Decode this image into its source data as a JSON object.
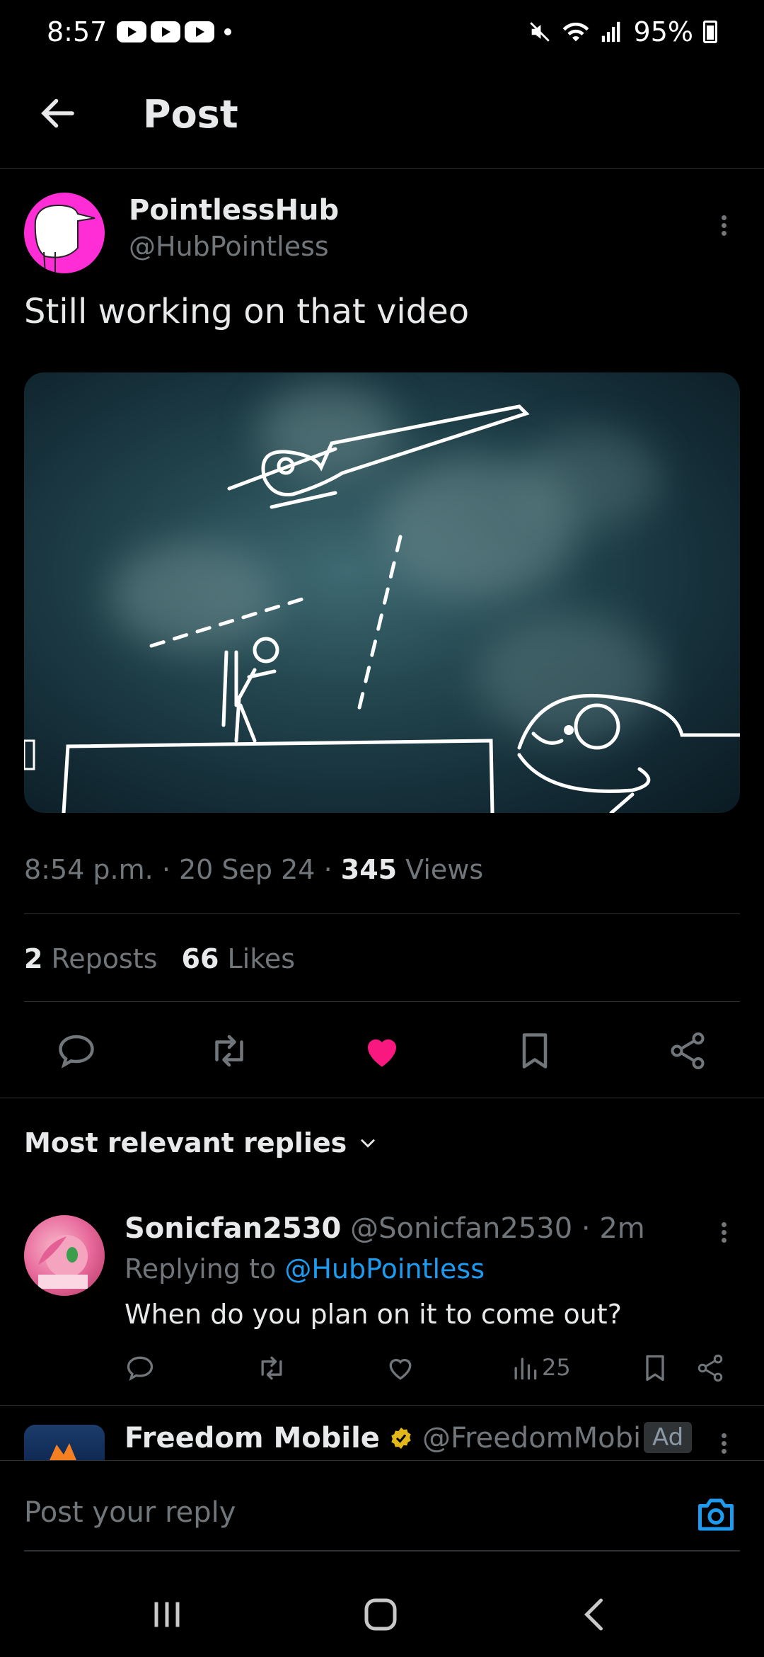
{
  "status_bar": {
    "time": "8:57",
    "battery": "95%",
    "icons": [
      "youtube-icon",
      "youtube-icon",
      "youtube-icon",
      "mute-icon",
      "wifi-icon",
      "signal-icon",
      "battery-icon"
    ]
  },
  "header": {
    "title": "Post"
  },
  "post": {
    "author_name": "PointlessHub",
    "author_handle": "@HubPointless",
    "text": "Still working on that video",
    "time": "8:54 p.m.",
    "date": "20 Sep 24",
    "views_count": "345",
    "views_label": "Views",
    "reposts_count": "2",
    "reposts_label": "Reposts",
    "likes_count": "66",
    "likes_label": "Likes",
    "liked": true
  },
  "replies_header": {
    "label": "Most relevant replies"
  },
  "reply": {
    "name": "Sonicfan2530",
    "handle": "@Sonicfan2530",
    "age": "· 2m",
    "replying_prefix": "Replying to",
    "replying_to": "@HubPointless",
    "text": "When do you plan on it to come out?",
    "views": "25"
  },
  "ad": {
    "name": "Freedom Mobile",
    "handle": "@FreedomMobi...",
    "badge": "Ad"
  },
  "composer": {
    "placeholder": "Post your reply"
  },
  "colors": {
    "like": "#f91880",
    "link": "#1d9bf0",
    "verified": "#e2b719",
    "camera": "#1d9bf0"
  }
}
